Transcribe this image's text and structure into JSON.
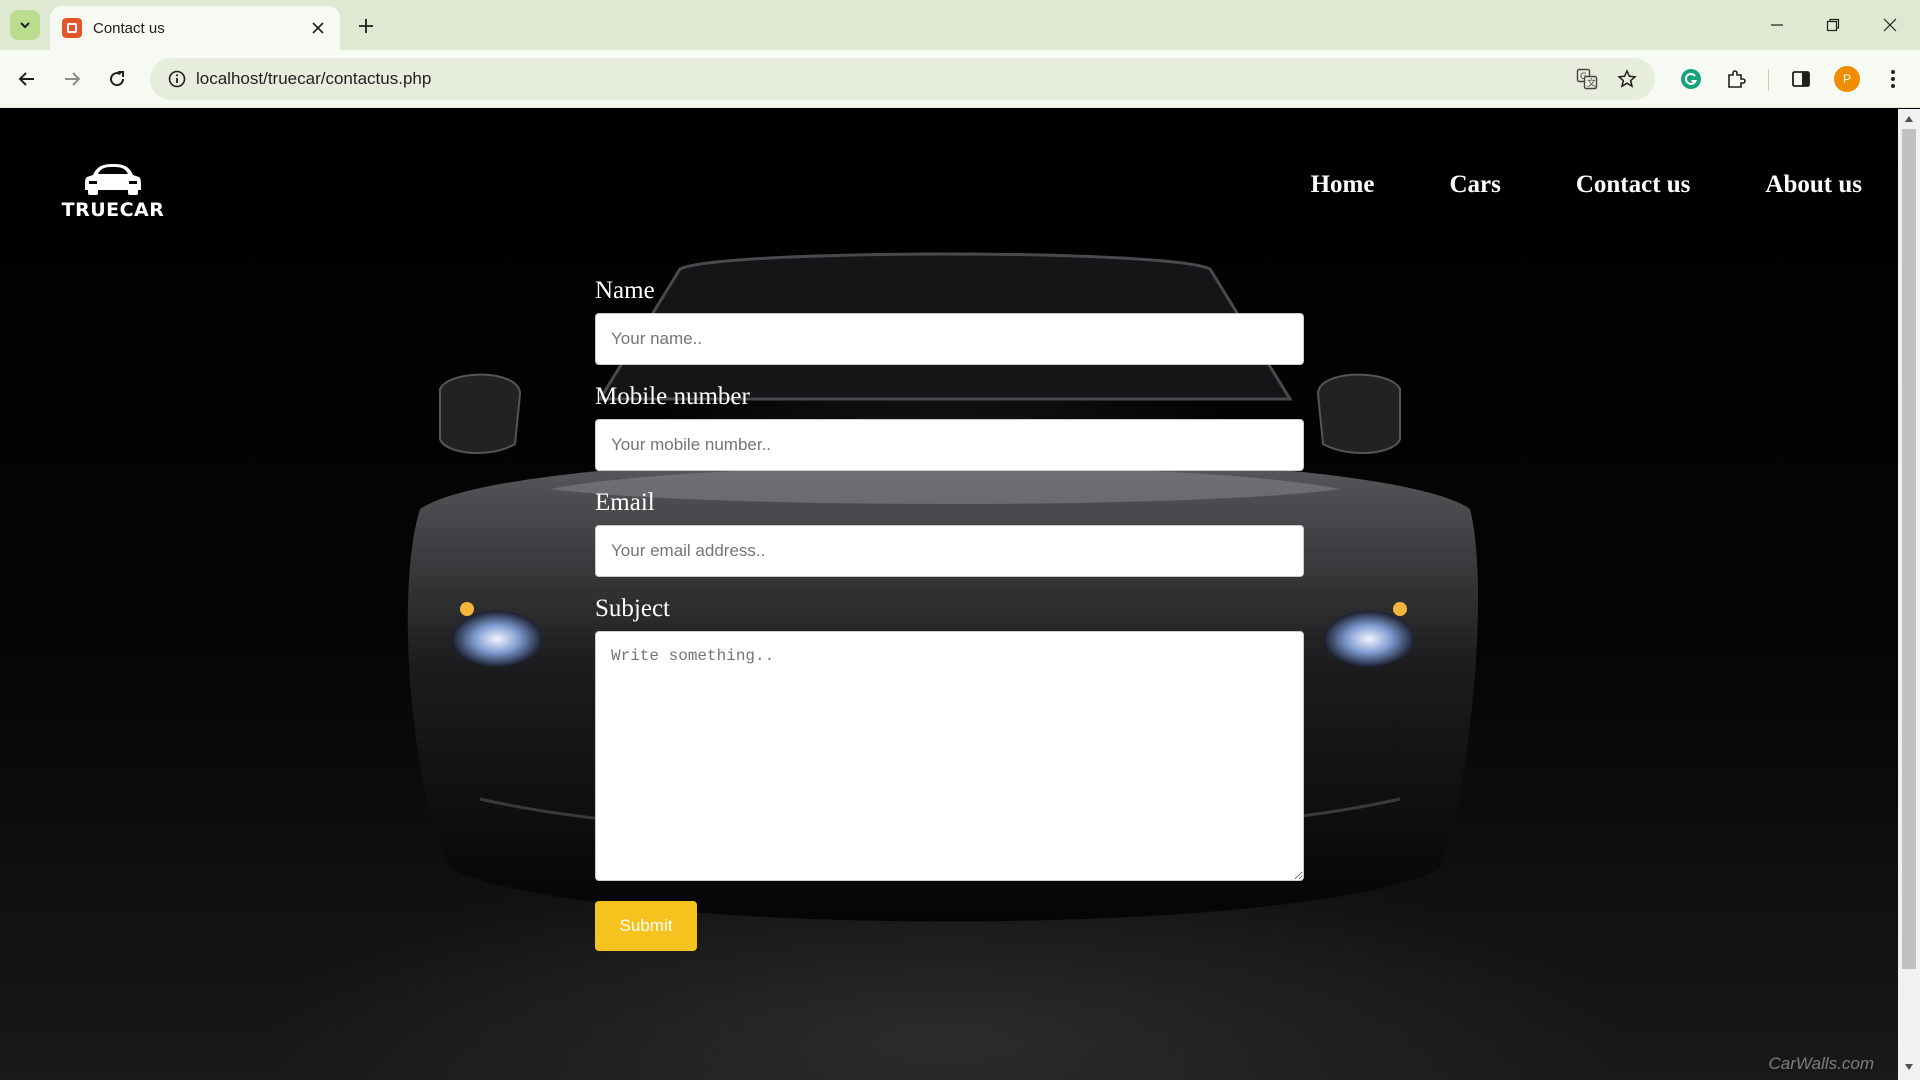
{
  "browser": {
    "tab_title": "Contact us",
    "url": "localhost/truecar/contactus.php",
    "profile_initial": "P"
  },
  "page": {
    "logo_text": "TRUECAR",
    "nav": [
      "Home",
      "Cars",
      "Contact us",
      "About us"
    ],
    "form": {
      "name_label": "Name",
      "name_placeholder": "Your name..",
      "mobile_label": "Mobile number",
      "mobile_placeholder": "Your mobile number..",
      "email_label": "Email",
      "email_placeholder": "Your email address..",
      "subject_label": "Subject",
      "subject_placeholder": "Write something..",
      "submit_label": "Submit"
    },
    "watermark": "CarWalls.com"
  },
  "colors": {
    "submit_button": "#f6c21d",
    "tabstrip": "#dfe9d2",
    "profile_avatar": "#f08c00"
  }
}
